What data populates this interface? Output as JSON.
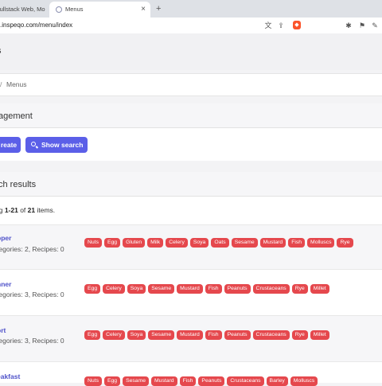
{
  "browser": {
    "tabs": [
      {
        "title": "Fullstack Web, Mo"
      },
      {
        "title": "Menus",
        "close": "×"
      }
    ],
    "new_tab": "+",
    "url": ".inspeqo.com/menu/index",
    "toolbar_icons": [
      "translate-icon",
      "share-icon",
      "brave-shield-icon",
      "extensions-icon",
      "bookmark-icon",
      "pen-icon"
    ]
  },
  "page": {
    "title": "s",
    "breadcrumb": {
      "separator": "/",
      "current": "Menus"
    }
  },
  "management": {
    "heading": "agement",
    "create_label": "reate",
    "search_label": "Show search"
  },
  "results": {
    "heading": "ch results",
    "summary_prefix": "ng ",
    "summary_range": "1-21",
    "summary_mid": " of ",
    "summary_total": "21",
    "summary_suffix": " items."
  },
  "rows": [
    {
      "name": "pper",
      "meta": "tegories: 2, Recipes: 0",
      "tags": [
        "Nuts",
        "Egg",
        "Gluten",
        "Milk",
        "Celery",
        "Soya",
        "Oats",
        "Sesame",
        "Mustard",
        "Fish",
        "Molluscs",
        "Rye"
      ]
    },
    {
      "name": "nner",
      "meta": "tegories: 3, Recipes: 0",
      "tags": [
        "Egg",
        "Celery",
        "Soya",
        "Sesame",
        "Mustard",
        "Fish",
        "Peanuts",
        "Crustaceans",
        "Rye",
        "Millet"
      ]
    },
    {
      "name": "ort",
      "meta": "tegories: 3, Recipes: 0",
      "tags": [
        "Egg",
        "Celery",
        "Soya",
        "Sesame",
        "Mustard",
        "Fish",
        "Peanuts",
        "Crustaceans",
        "Rye",
        "Millet"
      ]
    },
    {
      "name": "eakfast",
      "meta": "",
      "tags": [
        "Nuts",
        "Egg",
        "Sesame",
        "Mustard",
        "Fish",
        "Peanuts",
        "Crustaceans",
        "Barley",
        "Molluscs"
      ]
    }
  ],
  "colors": {
    "accent": "#5b5fe8",
    "tag": "#e5484d",
    "link": "#4f52c9"
  }
}
